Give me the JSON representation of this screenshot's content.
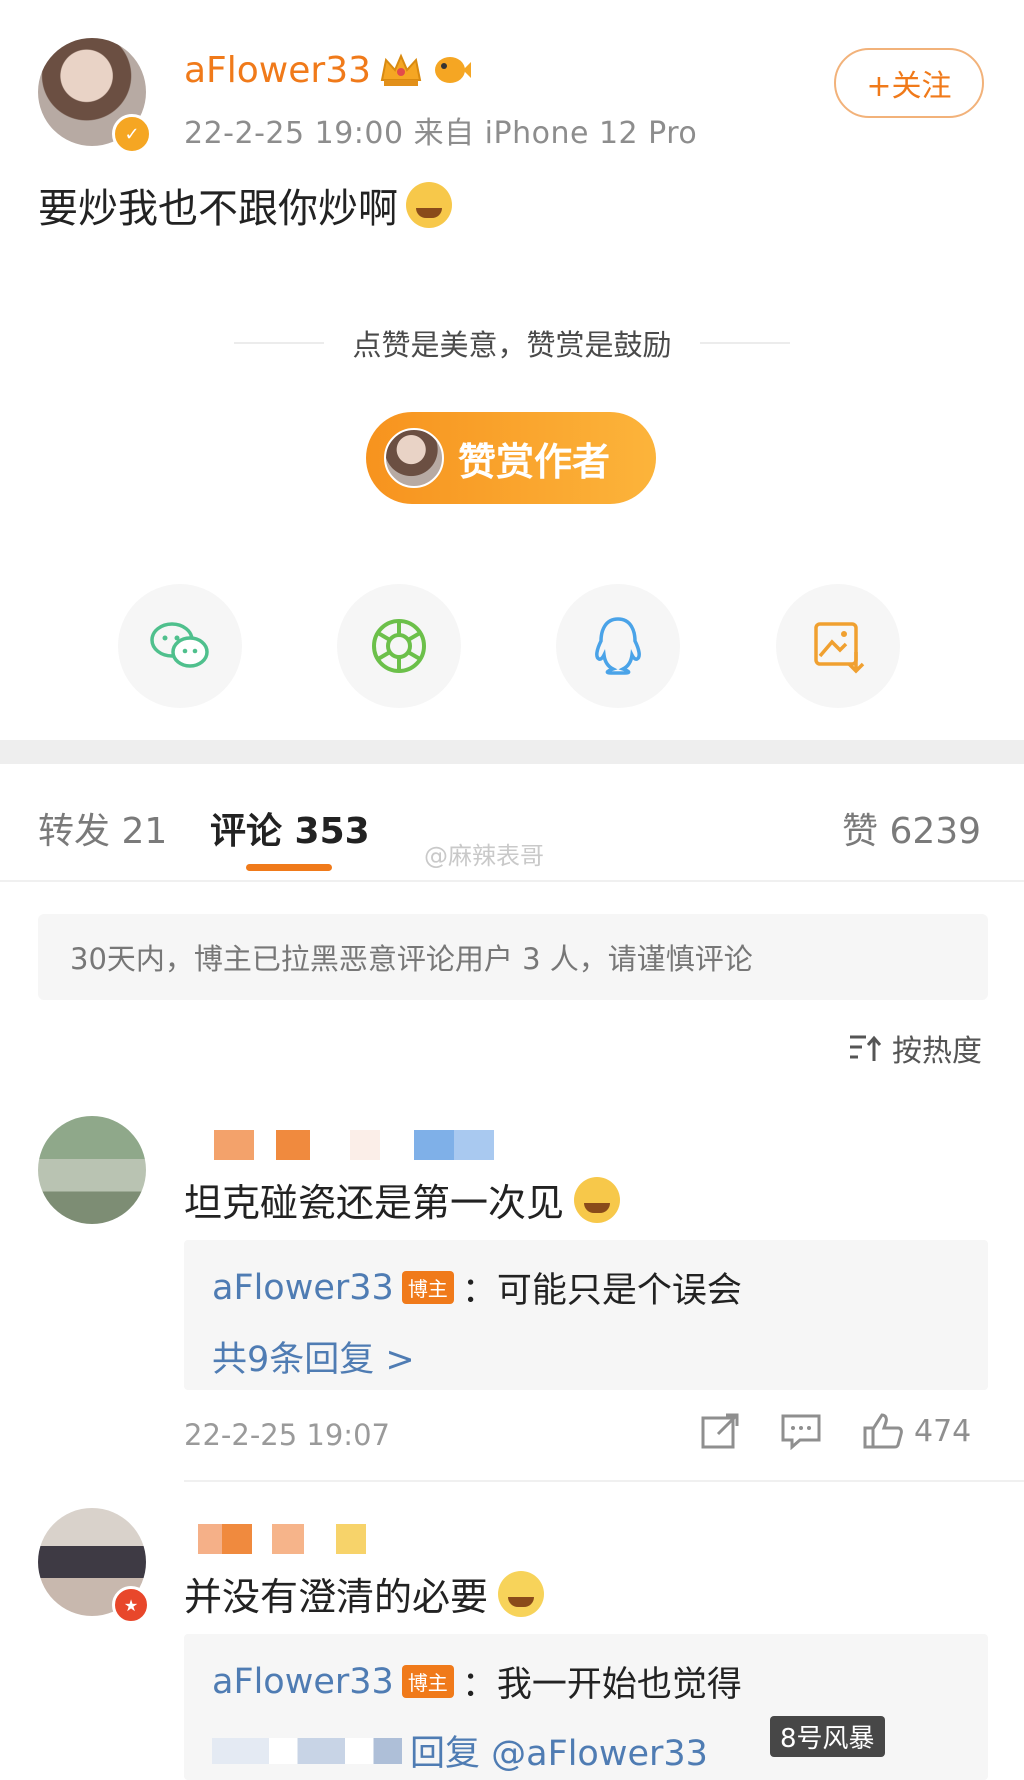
{
  "post": {
    "username": "aFlower33",
    "meta": "22-2-25 19:00  来自 iPhone 12 Pro",
    "follow_label": "+关注",
    "text": "要炒我也不跟你炒啊"
  },
  "reward": {
    "tagline": "点赞是美意，赞赏是鼓励",
    "button_label": "赞赏作者"
  },
  "share": {
    "icons": [
      "wechat-icon",
      "moments-icon",
      "qq-icon",
      "save-image-icon"
    ]
  },
  "tabs": {
    "repost": "转发 21",
    "comments": "评论 353",
    "likes": "赞 6239"
  },
  "watermark_top": "@麻辣表哥",
  "notice": "30天内，博主已拉黑恶意评论用户 3 人，请谨慎评论",
  "sort_label": "按热度",
  "comments": [
    {
      "text": "坦克碰瓷还是第一次见",
      "reply_user": "aFlower33",
      "host_tag": "博主",
      "reply_text": "：可能只是个误会",
      "more_replies": "共9条回复 >",
      "time": "22-2-25 19:07",
      "likes": "474"
    },
    {
      "text": "并没有澄清的必要",
      "reply_user": "aFlower33",
      "host_tag": "博主",
      "reply_text": "：我一开始也觉得",
      "reply2_text": "回复 @aFlower33"
    }
  ],
  "watermark_bottom": "8号风暴",
  "colors": {
    "accent": "#f07a1a",
    "link_blue": "#4f7cb3",
    "reward_gradient_start": "#f7931e",
    "reward_gradient_end": "#fcb43b"
  }
}
